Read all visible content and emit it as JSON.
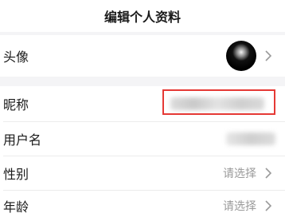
{
  "header": {
    "title": "编辑个人资料"
  },
  "rows": {
    "avatar": {
      "label": "头像"
    },
    "nickname": {
      "label": "昵称"
    },
    "username": {
      "label": "用户名"
    },
    "gender": {
      "label": "性别",
      "placeholder": "请选择"
    },
    "age": {
      "label": "年龄",
      "placeholder": "请选择"
    }
  },
  "icons": {
    "chevron": "chevron-right-icon"
  },
  "colors": {
    "highlight": "#e53935",
    "placeholder": "#9a9a9a",
    "background": "#f4f4f6"
  }
}
